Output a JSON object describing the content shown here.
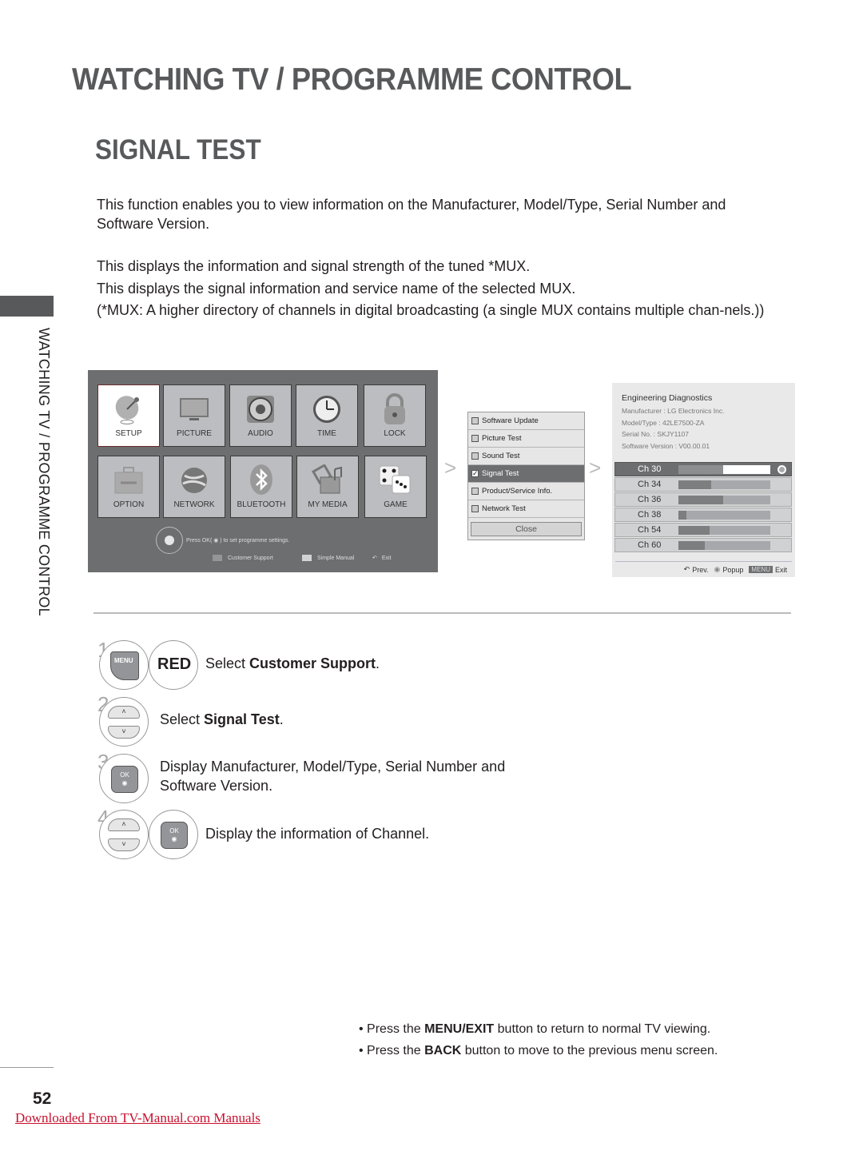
{
  "header": {
    "section_title": "WATCHING TV / PROGRAMME CONTROL",
    "page_title": "SIGNAL TEST"
  },
  "side_tab": {
    "label": "WATCHING TV / PROGRAMME CONTROL"
  },
  "intro": {
    "p1": "This function enables you to view information on the Manufacturer, Model/Type, Serial Number and Software Version.",
    "p2": "This displays the information and signal strength of the tuned *MUX.",
    "p3": "This displays the signal information and service name of the selected MUX.",
    "p4": "(*MUX: A higher directory of channels in digital broadcasting (a single MUX contains multiple chan-nels.))"
  },
  "main_menu": {
    "tiles": [
      {
        "label": "SETUP",
        "icon": "satellite-dish-icon",
        "active": true
      },
      {
        "label": "PICTURE",
        "icon": "tv-icon"
      },
      {
        "label": "AUDIO",
        "icon": "speaker-icon"
      },
      {
        "label": "TIME",
        "icon": "clock-icon"
      },
      {
        "label": "LOCK",
        "icon": "padlock-icon"
      },
      {
        "label": "OPTION",
        "icon": "toolbox-icon"
      },
      {
        "label": "NETWORK",
        "icon": "globe-icon"
      },
      {
        "label": "BLUETOOTH",
        "icon": "bluetooth-icon"
      },
      {
        "label": "MY MEDIA",
        "icon": "media-icon"
      },
      {
        "label": "GAME",
        "icon": "dice-icon"
      }
    ],
    "hint": "Press OK( ◉ ) to set programme settings.",
    "legend": {
      "customer_support": "Customer Support",
      "simple_manual": "Simple Manual",
      "exit": "Exit"
    },
    "colors": {
      "background": "#6d6e70",
      "tile": "#bcbdc0",
      "red_swatch": "#939598",
      "simple_swatch": "#d1d2d4"
    }
  },
  "customer_support_menu": {
    "items": [
      {
        "label": "Software Update",
        "checked": false
      },
      {
        "label": "Picture Test",
        "checked": false
      },
      {
        "label": "Sound Test",
        "checked": false
      },
      {
        "label": "Signal Test",
        "checked": true,
        "selected": true
      },
      {
        "label": "Product/Service Info.",
        "checked": false
      },
      {
        "label": "Network Test",
        "checked": false
      }
    ],
    "close_label": "Close",
    "arrow": ">"
  },
  "diagnostics": {
    "title": "Engineering Diagnostics",
    "manufacturer": "Manufacturer : LG Electronics Inc.",
    "model": "Model/Type : 42LE7500-ZA",
    "serial": "Serial No. : SKJY1107",
    "software": "Software Version : V00.00.01",
    "channels": [
      {
        "name": "Ch 30",
        "signal": 0.49,
        "selected": true
      },
      {
        "name": "Ch 34",
        "signal": 0.36
      },
      {
        "name": "Ch 36",
        "signal": 0.49
      },
      {
        "name": "Ch 38",
        "signal": 0.09
      },
      {
        "name": "Ch 54",
        "signal": 0.34
      },
      {
        "name": "Ch 60",
        "signal": 0.29
      }
    ],
    "footer": {
      "prev": "Prev.",
      "popup": "Popup",
      "menu_chip": "MENU",
      "exit": "Exit"
    }
  },
  "steps": [
    {
      "num": "1",
      "key1": "MENU",
      "key2": "RED",
      "pre": "Select ",
      "bold": "Customer Support",
      "post": "."
    },
    {
      "num": "2",
      "pre": "Select ",
      "bold": "Signal Test",
      "post": "."
    },
    {
      "num": "3",
      "key": "OK",
      "line1": "Display Manufacturer, Model/Type, Serial Number and",
      "line2": "Software Version."
    },
    {
      "num": "4",
      "key": "OK",
      "text": "Display the information of Channel."
    }
  ],
  "keys": {
    "up": "˄",
    "down": "˅",
    "ok_dot": "◉"
  },
  "notes": [
    {
      "pre": "• Press the ",
      "bold": "MENU/EXIT",
      "post": " button to return to normal TV viewing."
    },
    {
      "pre": "• Press the ",
      "bold": "BACK",
      "post": " button to move to the previous menu screen."
    }
  ],
  "footer": {
    "page_number": "52",
    "download_link": "Downloaded From TV-Manual.com Manuals"
  }
}
